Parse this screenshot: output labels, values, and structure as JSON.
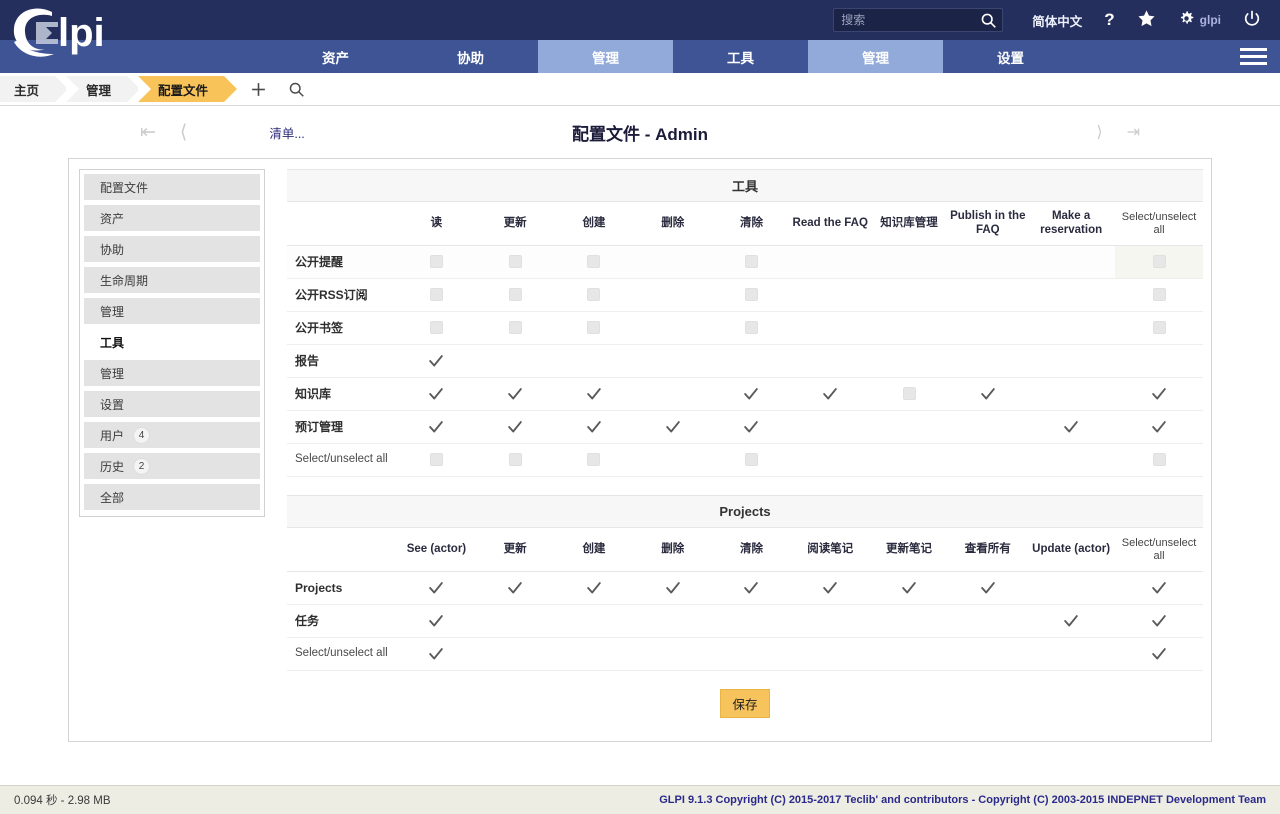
{
  "header": {
    "logo_text": "Glpi",
    "search": {
      "placeholder": "搜索",
      "value": ""
    },
    "language": "简体中文",
    "help_icon": "question-mark-icon",
    "favorites_icon": "star-icon",
    "settings_icon": "gear-icon",
    "user_name": "glpi",
    "power_icon": "power-icon"
  },
  "nav": {
    "items": [
      {
        "label": "资产",
        "active": false
      },
      {
        "label": "协助",
        "active": false
      },
      {
        "label": "管理",
        "active": true
      },
      {
        "label": "工具",
        "active": false
      },
      {
        "label": "管理",
        "active": true
      },
      {
        "label": "设置",
        "active": false
      }
    ],
    "menu_icon": "hamburger-menu-icon"
  },
  "breadcrumb": {
    "items": [
      {
        "label": "主页",
        "active": false
      },
      {
        "label": "管理",
        "active": false
      },
      {
        "label": "配置文件",
        "active": true
      }
    ],
    "add_icon": "plus-icon",
    "search_icon": "search-icon"
  },
  "title_row": {
    "first_icon": "first-page-icon",
    "prev_icon": "previous-page-icon",
    "inventory_link": "清单...",
    "title": "配置文件 - Admin",
    "next_icon": "next-page-icon",
    "last_icon": "last-page-icon"
  },
  "sidebar": {
    "items": [
      {
        "label": "配置文件",
        "badge": "",
        "active": false
      },
      {
        "label": "资产",
        "badge": "",
        "active": false
      },
      {
        "label": "协助",
        "badge": "",
        "active": false
      },
      {
        "label": "生命周期",
        "badge": "",
        "active": false
      },
      {
        "label": "管理",
        "badge": "",
        "active": false
      },
      {
        "label": "工具",
        "badge": "",
        "active": true
      },
      {
        "label": "管理",
        "badge": "",
        "active": false
      },
      {
        "label": "设置",
        "badge": "",
        "active": false
      },
      {
        "label": "用户",
        "badge": "4",
        "active": false
      },
      {
        "label": "历史",
        "badge": "2",
        "active": false
      },
      {
        "label": "全部",
        "badge": "",
        "active": false
      }
    ]
  },
  "tables": [
    {
      "section_title": "工具",
      "columns": [
        {
          "label": "读",
          "bold": true
        },
        {
          "label": "更新",
          "bold": true
        },
        {
          "label": "创建",
          "bold": true
        },
        {
          "label": "删除",
          "bold": true
        },
        {
          "label": "清除",
          "bold": true
        },
        {
          "label": "Read the FAQ",
          "bold": true
        },
        {
          "label": "知识库管理",
          "bold": true
        },
        {
          "label": "Publish in the FAQ",
          "bold": true
        },
        {
          "label": "Make a reservation",
          "bold": true
        },
        {
          "label": "Select/unselect all",
          "bold": false
        }
      ],
      "rows": [
        {
          "label": "公开提醒",
          "lite": false,
          "highlight": true,
          "cells": [
            "box",
            "box",
            "box",
            "none",
            "box",
            "none",
            "none",
            "none",
            "none",
            "box"
          ]
        },
        {
          "label": "公开RSS订阅",
          "lite": false,
          "highlight": false,
          "cells": [
            "box",
            "box",
            "box",
            "none",
            "box",
            "none",
            "none",
            "none",
            "none",
            "box"
          ]
        },
        {
          "label": "公开书签",
          "lite": false,
          "highlight": false,
          "cells": [
            "box",
            "box",
            "box",
            "none",
            "box",
            "none",
            "none",
            "none",
            "none",
            "box"
          ]
        },
        {
          "label": "报告",
          "lite": false,
          "highlight": false,
          "cells": [
            "check",
            "none",
            "none",
            "none",
            "none",
            "none",
            "none",
            "none",
            "none",
            "none"
          ]
        },
        {
          "label": "知识库",
          "lite": false,
          "highlight": false,
          "cells": [
            "check",
            "check",
            "check",
            "none",
            "check",
            "check",
            "box",
            "check",
            "none",
            "check"
          ]
        },
        {
          "label": "预订管理",
          "lite": false,
          "highlight": false,
          "cells": [
            "check",
            "check",
            "check",
            "check",
            "check",
            "none",
            "none",
            "none",
            "check",
            "check"
          ]
        },
        {
          "label": "Select/unselect all",
          "lite": true,
          "highlight": false,
          "cells": [
            "box",
            "box",
            "box",
            "none",
            "box",
            "none",
            "none",
            "none",
            "none",
            "box"
          ]
        }
      ]
    },
    {
      "section_title": "Projects",
      "columns": [
        {
          "label": "See (actor)",
          "bold": true
        },
        {
          "label": "更新",
          "bold": true
        },
        {
          "label": "创建",
          "bold": true
        },
        {
          "label": "删除",
          "bold": true
        },
        {
          "label": "清除",
          "bold": true
        },
        {
          "label": "阅读笔记",
          "bold": true
        },
        {
          "label": "更新笔记",
          "bold": true
        },
        {
          "label": "查看所有",
          "bold": true
        },
        {
          "label": "Update (actor)",
          "bold": true
        },
        {
          "label": "Select/unselect all",
          "bold": false
        }
      ],
      "rows": [
        {
          "label": "Projects",
          "lite": false,
          "highlight": false,
          "cells": [
            "check",
            "check",
            "check",
            "check",
            "check",
            "check",
            "check",
            "check",
            "none",
            "check"
          ]
        },
        {
          "label": "任务",
          "lite": false,
          "highlight": false,
          "cells": [
            "check",
            "none",
            "none",
            "none",
            "none",
            "none",
            "none",
            "none",
            "check",
            "check"
          ]
        },
        {
          "label": "Select/unselect all",
          "lite": true,
          "highlight": false,
          "cells": [
            "check",
            "none",
            "none",
            "none",
            "none",
            "none",
            "none",
            "none",
            "none",
            "check"
          ]
        }
      ]
    }
  ],
  "save": {
    "label": "保存"
  },
  "footer": {
    "left": "0.094 秒 - 2.98 MB",
    "right": "GLPI 9.1.3 Copyright (C) 2015-2017 Teclib' and contributors - Copyright (C) 2003-2015 INDEPNET Development Team"
  },
  "colors": {
    "header_bg": "#252f5e",
    "nav_bg": "#3f5495",
    "nav_active": "#92aada",
    "crumb_active": "#f8c45a",
    "save_bg": "#f6c35c",
    "footer_bg": "#eeede4",
    "footer_link": "#2a2a8a"
  }
}
